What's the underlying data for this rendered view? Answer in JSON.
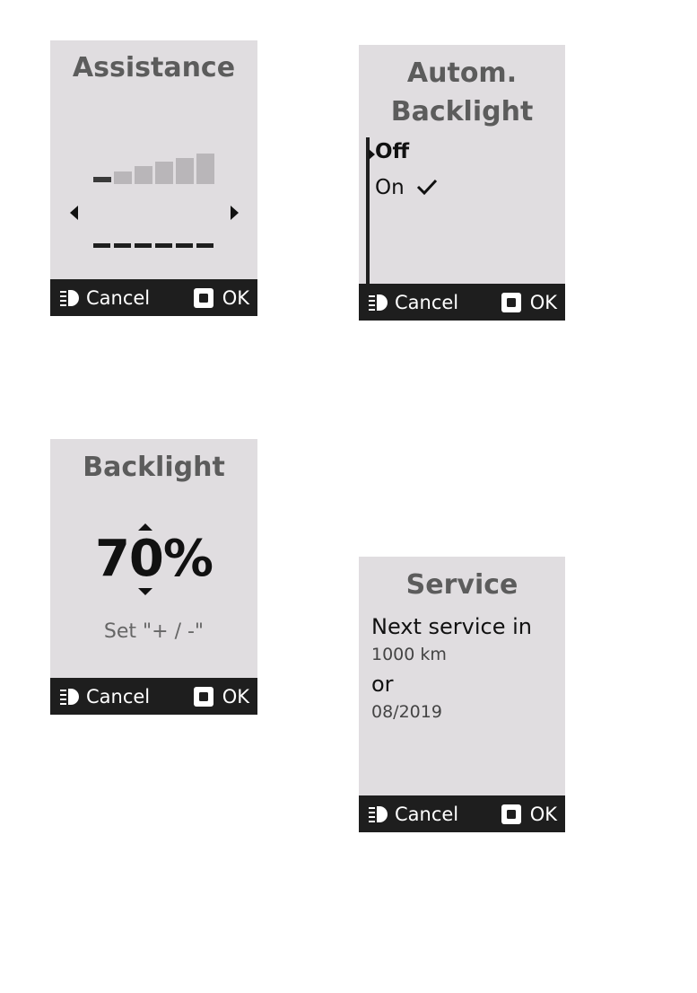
{
  "colors": {
    "screen_bg": "#e0dde0",
    "footer_bg": "#1e1e1e",
    "title_color": "#5c5c5c",
    "inactive_bar": "#b9b6b9"
  },
  "footer": {
    "cancel_label": "Cancel",
    "ok_label": "OK",
    "cancel_icon": "headlight-icon",
    "ok_icon": "square-button-icon"
  },
  "assistance": {
    "title": "Assistance",
    "levels_total": 6,
    "level_selected": 1
  },
  "autom_backlight": {
    "title_line1": "Autom.",
    "title_line2": "Backlight",
    "options": [
      {
        "label": "Off",
        "highlighted": true,
        "checked": false
      },
      {
        "label": "On",
        "highlighted": false,
        "checked": true
      }
    ],
    "check_glyph": "✓"
  },
  "backlight": {
    "title": "Backlight",
    "value": "70%",
    "hint": "Set \"+ / -\""
  },
  "service": {
    "title": "Service",
    "line1": "Next service in",
    "distance": "1000 km",
    "or": "or",
    "date": "08/2019"
  }
}
